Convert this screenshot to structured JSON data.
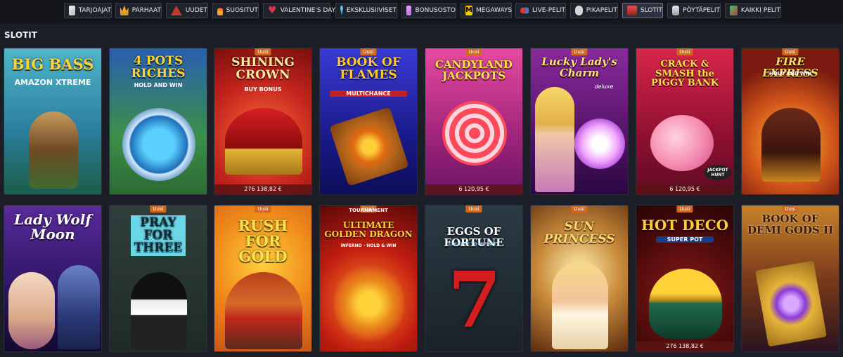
{
  "nav": {
    "items": [
      {
        "label": "TARJOAJAT",
        "icon": "cards-icon"
      },
      {
        "label": "PARHAAT",
        "icon": "crown-icon"
      },
      {
        "label": "UUDET",
        "icon": "new-icon"
      },
      {
        "label": "SUOSITUT",
        "icon": "fire-icon"
      },
      {
        "label": "VALENTINE'S DAY",
        "icon": "heart-icon"
      },
      {
        "label": "EKSKLUSIIVISET",
        "icon": "diamond-icon"
      },
      {
        "label": "BONUSOSTO",
        "icon": "bonus-icon"
      },
      {
        "label": "MEGAWAYS",
        "icon": "megaways-icon"
      },
      {
        "label": "LIVE-PELIT",
        "icon": "chips-icon"
      },
      {
        "label": "PIKAPELIT",
        "icon": "gamepad-icon"
      },
      {
        "label": "SLOTIT",
        "icon": "slot-icon"
      },
      {
        "label": "PÖYTÄPELIT",
        "icon": "table-icon"
      },
      {
        "label": "KAIKKI PELIT",
        "icon": "all-games-icon"
      }
    ],
    "active": "SLOTIT"
  },
  "section": {
    "title": "SLOTIT"
  },
  "games": [
    {
      "title": "BIG BASS",
      "subtitle": "AMAZON XTREME",
      "badge": "",
      "jackpot": ""
    },
    {
      "title": "4 POTS RICHES",
      "subtitle": "HOLD AND WIN",
      "badge": "",
      "jackpot": ""
    },
    {
      "title": "SHINING CROWN",
      "subtitle": "BUY BONUS",
      "badge": "Uusi",
      "jackpot": "276 138,82 €"
    },
    {
      "title": "BOOK OF FLAMES",
      "subtitle": "MULTICHANCE",
      "badge": "Uusi",
      "jackpot": ""
    },
    {
      "title": "CANDYLAND JACKPOTS",
      "subtitle": "",
      "badge": "Uusi",
      "jackpot": "6 120,95 €"
    },
    {
      "title": "Lucky Lady's Charm",
      "subtitle": "deluxe",
      "badge": "Uusi",
      "jackpot": ""
    },
    {
      "title": "CRACK & SMASH the PIGGY BANK",
      "subtitle": "JACKPOT HUNT",
      "badge": "Uusi",
      "jackpot": "6 120,95 €"
    },
    {
      "title": "FIRE EXPRESS",
      "subtitle": "HOLD AND WIN",
      "badge": "Uusi",
      "jackpot": ""
    },
    {
      "title": "Lady Wolf Moon",
      "subtitle": "",
      "badge": "",
      "jackpot": ""
    },
    {
      "title": "PRAY FOR THREE",
      "subtitle": "",
      "badge": "Uusi",
      "jackpot": ""
    },
    {
      "title": "RUSH FOR GOLD",
      "subtitle": "",
      "badge": "Uusi",
      "jackpot": ""
    },
    {
      "title": "ULTIMATE GOLDEN DRAGON",
      "subtitle": "INFERNO · HOLD & WIN",
      "badge": "Uusi",
      "jackpot": "",
      "tag": "TOURNAMENT"
    },
    {
      "title": "EGGS OF FORTUNE",
      "subtitle": "COLLECT TO INFINITY",
      "badge": "Uusi",
      "jackpot": ""
    },
    {
      "title": "SUN PRINCESS",
      "subtitle": "",
      "badge": "Uusi",
      "jackpot": ""
    },
    {
      "title": "HOT DECO",
      "subtitle": "SUPER POT",
      "badge": "Uusi",
      "jackpot": "276 138,82 €"
    },
    {
      "title": "BOOK OF DEMI GODS II",
      "subtitle": "",
      "badge": "Uusi",
      "jackpot": ""
    }
  ]
}
